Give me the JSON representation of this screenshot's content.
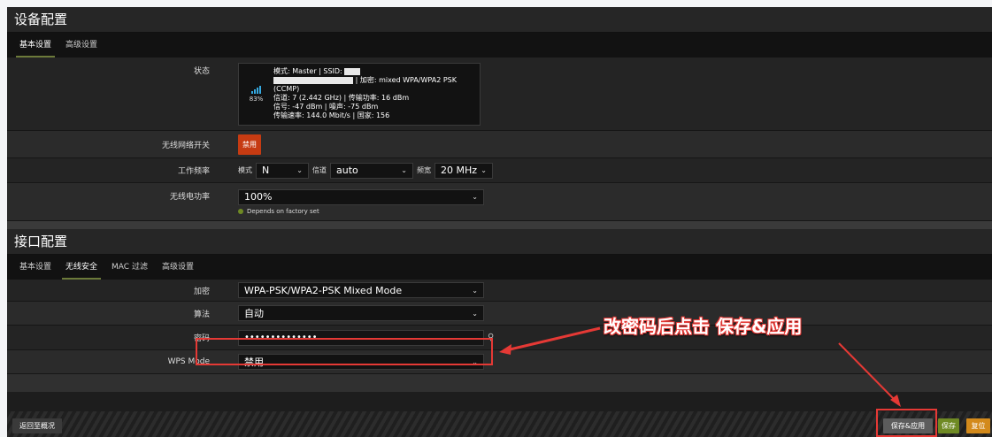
{
  "device_config": {
    "title": "设备配置",
    "tabs": [
      {
        "label": "基本设置",
        "active": true
      },
      {
        "label": "高级设置",
        "active": false
      }
    ],
    "status_label": "状态",
    "status": {
      "signal_percent": "83%",
      "line1_mode": "模式: Master | SSID:",
      "line2": "| 加密: mixed WPA/WPA2 PSK (CCMP)",
      "line3": "信道: 7 (2.442 GHz) | 传输功率: 16 dBm",
      "line4": "信号: -47 dBm | 噪声: -75 dBm",
      "line5": "传输速率: 144.0 Mbit/s | 国家: 156"
    },
    "wireless_switch_label": "无线网络开关",
    "wireless_switch_button": "禁用",
    "freq_label": "工作频率",
    "mode_label": "模式",
    "mode_value": "N",
    "channel_label": "信道",
    "channel_value": "auto",
    "width_label": "频宽",
    "width_value": "20 MHz",
    "power_label": "无线电功率",
    "power_value": "100%",
    "power_hint": "Depends on factory set"
  },
  "interface_config": {
    "title": "接口配置",
    "tabs": [
      {
        "label": "基本设置",
        "active": false
      },
      {
        "label": "无线安全",
        "active": true
      },
      {
        "label": "MAC 过滤",
        "active": false
      },
      {
        "label": "高级设置",
        "active": false
      }
    ],
    "encryption_label": "加密",
    "encryption_value": "WPA-PSK/WPA2-PSK Mixed Mode",
    "algorithm_label": "算法",
    "algorithm_value": "自动",
    "password_label": "密码",
    "password_value": "••••••••••••••",
    "wps_label": "WPS Mode",
    "wps_value": "禁用"
  },
  "footer": {
    "back_label": "返回至概况",
    "save_apply_label": "保存&应用",
    "save_label": "保存",
    "reset_label": "复位"
  },
  "annotation": {
    "text": "改密码后点击 保存&应用"
  },
  "colors": {
    "disable_button": "#c63b12",
    "save_button": "#6f8a24",
    "reset_button": "#d38a1b",
    "highlight": "#e53935",
    "accent_tab": "#6c7a3a"
  }
}
